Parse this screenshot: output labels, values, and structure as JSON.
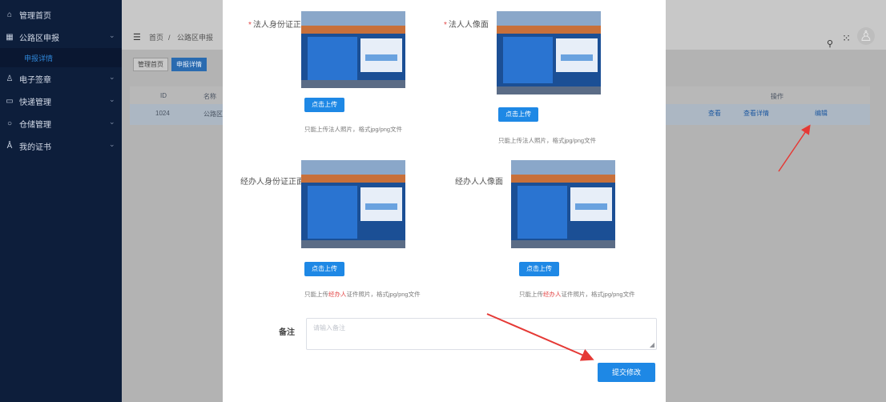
{
  "sidebar": {
    "items": [
      {
        "label": "管理首页",
        "icon": "home-icon"
      },
      {
        "label": "公路区申报",
        "icon": "grid-icon"
      },
      {
        "label": "电子签章",
        "icon": "user-icon"
      },
      {
        "label": "快递管理",
        "icon": "folder-icon"
      },
      {
        "label": "仓储管理",
        "icon": "circle-icon"
      },
      {
        "label": "我的证书",
        "icon": "person-icon"
      }
    ],
    "sub_item": "申报详情"
  },
  "header": {
    "breadcrumb": [
      "首页",
      "公路区申报"
    ],
    "tags": [
      "管理首页",
      "申报详情"
    ]
  },
  "table": {
    "columns": [
      "ID",
      "名称",
      "操作"
    ],
    "row": {
      "id": "1024",
      "name": "公路区",
      "actions": [
        "查看",
        "查看详情",
        "编辑"
      ]
    }
  },
  "modal": {
    "fields": [
      {
        "label": "法人身份证正面",
        "required": true,
        "upload": "点击上传",
        "hint_pre": "只能上传法人照片，格式jpg/png文件",
        "hint_red": ""
      },
      {
        "label": "法人人像面",
        "required": true,
        "upload": "点击上传",
        "hint_pre": "只能上传法人照片，格式jpg/png文件",
        "hint_red": ""
      },
      {
        "label": "经办人身份证正面",
        "required": false,
        "upload": "点击上传",
        "hint_pre": "只能上传",
        "hint_red": "经办人",
        "hint_post": "证件照片，格式jpg/png文件"
      },
      {
        "label": "经办人人像面",
        "required": false,
        "upload": "点击上传",
        "hint_pre": "只能上传",
        "hint_red": "经办人",
        "hint_post": "证件照片，格式jpg/png文件"
      }
    ],
    "remark_label": "备注",
    "remark_placeholder": "请输入备注",
    "submit_label": "提交修改"
  },
  "colors": {
    "accent": "#1e88e5",
    "sidebar": "#0d1e3b",
    "arrow": "#e53935"
  }
}
